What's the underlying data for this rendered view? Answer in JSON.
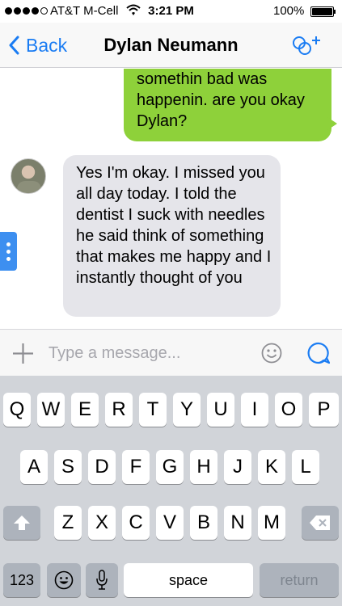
{
  "status_bar": {
    "carrier": "AT&T M-Cell",
    "time": "3:21 PM",
    "battery_percent": "100%",
    "signal_bars_filled": 4,
    "signal_bars_total": 5,
    "battery_level": 1.0
  },
  "nav": {
    "back_label": "Back",
    "title": "Dylan Neumann",
    "tint_color": "#1a7cf3",
    "add_icon": "add-people-icon"
  },
  "messages": [
    {
      "direction": "outgoing",
      "text": "somethin bad was happenin. are you okay Dylan?",
      "color": "#8ed13a"
    },
    {
      "direction": "incoming",
      "text": "Yes I'm okay. I missed you all day today. I told the dentist I suck with needles he said think of something that makes me happy and I instantly thought of you",
      "color": "#e5e5ea"
    }
  ],
  "composer": {
    "placeholder": "Type a message...",
    "value": "",
    "plus_icon": "plus-icon",
    "emoji_icon": "smiley-icon",
    "send_icon": "chat-bubble-icon"
  },
  "keyboard": {
    "row1": [
      "Q",
      "W",
      "E",
      "R",
      "T",
      "Y",
      "U",
      "I",
      "O",
      "P"
    ],
    "row2": [
      "A",
      "S",
      "D",
      "F",
      "G",
      "H",
      "J",
      "K",
      "L"
    ],
    "row3": [
      "Z",
      "X",
      "C",
      "V",
      "B",
      "N",
      "M"
    ],
    "numbers_key": "123",
    "space_key": "space",
    "return_key": "return",
    "shift_icon": "shift-icon",
    "delete_icon": "delete-icon",
    "emoji_icon": "emoji-key-icon",
    "mic_icon": "microphone-icon"
  }
}
